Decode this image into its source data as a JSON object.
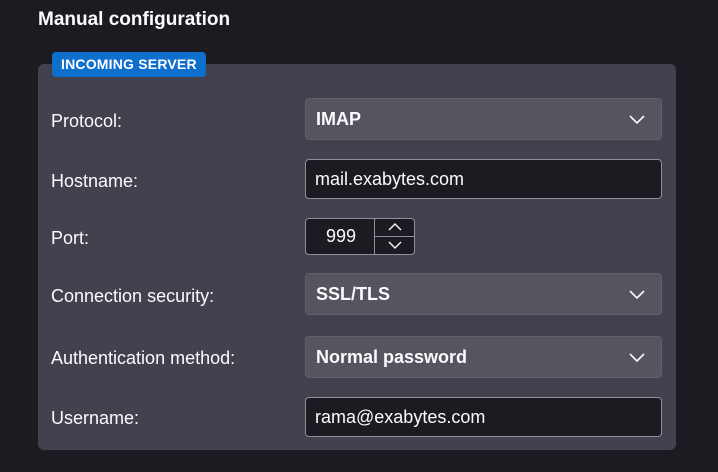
{
  "section_title": "Manual configuration",
  "incoming_server": {
    "badge": "INCOMING SERVER",
    "protocol": {
      "label": "Protocol:",
      "value": "IMAP"
    },
    "hostname": {
      "label": "Hostname:",
      "value": "mail.exabytes.com"
    },
    "port": {
      "label": "Port:",
      "value": "999"
    },
    "connection_security": {
      "label": "Connection security:",
      "value": "SSL/TLS"
    },
    "authentication_method": {
      "label": "Authentication method:",
      "value": "Normal password"
    },
    "username": {
      "label": "Username:",
      "value": "rama@exabytes.com"
    }
  },
  "icons": {
    "dropdown": "chevron-down-icon",
    "increment": "chevron-up-icon",
    "decrement": "chevron-down-icon"
  },
  "colors": {
    "background": "#1c1b22",
    "panel": "#42414d",
    "badge": "#0e6fcd",
    "text": "#fbfbfe"
  }
}
